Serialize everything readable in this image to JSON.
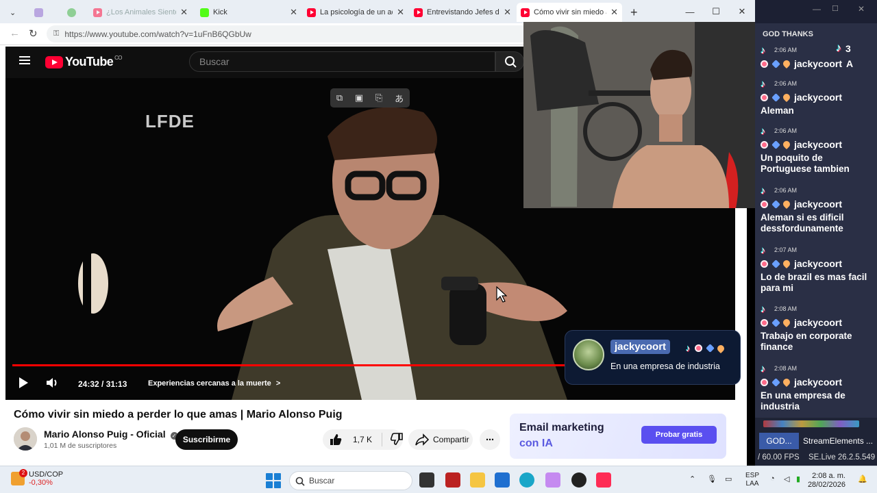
{
  "browser": {
    "tabs": [
      {
        "title": "",
        "muted": true,
        "active": false
      },
      {
        "title": "",
        "muted": true,
        "active": false
      },
      {
        "title": "¿Los Animales Sienten A",
        "muted": true,
        "active": false
      },
      {
        "title": "Kick",
        "muted": false,
        "active": false
      },
      {
        "title": "La psicología de un adic",
        "muted": false,
        "active": false
      },
      {
        "title": "Entrevistando Jefes de N",
        "muted": false,
        "active": false
      },
      {
        "title": "Cómo vivir sin miedo a p",
        "muted": false,
        "active": true
      }
    ],
    "new_tab": "+",
    "url": "https://www.youtube.com/watch?v=1uFnB6QGbUw"
  },
  "youtube": {
    "logo_text": "YouTube",
    "country": "CO",
    "search_placeholder": "Buscar",
    "video": {
      "watermark": "LFDE",
      "progress": 0.785,
      "time": "24:32 / 31:13",
      "chapter": "Experiencias cercanas a la muerte",
      "chapter_chevron": ">"
    },
    "title": "Cómo vivir sin miedo a perder lo que amas | Mario Alonso Puig",
    "channel": {
      "name": "Mario Alonso Puig - Oficial",
      "subscribers": "1,01 M de suscriptores",
      "subscribe_label": "Suscribirme"
    },
    "likes": "1,7 K",
    "share_label": "Compartir",
    "more_label": "⋯",
    "ad": {
      "line1": "Email marketing",
      "line2": "con IA",
      "cta": "Probar gratis"
    }
  },
  "popup": {
    "user": "jackycoort",
    "message": "En una empresa de industria"
  },
  "chat": {
    "header": "GOD THANKS",
    "tiktok_count": "3",
    "messages": [
      {
        "time": "2:06 AM",
        "user": "jackycoort",
        "suffix": "A",
        "text": ""
      },
      {
        "time": "2:06 AM",
        "user": "jackycoort",
        "suffix": "",
        "text": "Aleman"
      },
      {
        "time": "2:06 AM",
        "user": "jackycoort",
        "suffix": "",
        "text": "Un poquito de Portuguese tambien"
      },
      {
        "time": "2:06 AM",
        "user": "jackycoort",
        "suffix": "",
        "text": "Aleman si es dificil dessfordunamente"
      },
      {
        "time": "2:07 AM",
        "user": "jackycoort",
        "suffix": "",
        "text": "Lo de brazil es mas facil para mi"
      },
      {
        "time": "2:08 AM",
        "user": "jackycoort",
        "suffix": "",
        "text": "Trabajo en corporate finance"
      },
      {
        "time": "2:08 AM",
        "user": "jackycoort",
        "suffix": "",
        "text": "En una empresa de industria"
      }
    ],
    "tab_god": "GOD...",
    "tab_streamelements": "StreamElements ...",
    "fps": "/ 60.00 FPS",
    "selive": "SE.Live 26.2.5.549"
  },
  "taskbar": {
    "ticker_badge": "2",
    "ticker_name": "USD/COP",
    "ticker_value": "-0,30%",
    "search_placeholder": "Buscar",
    "lang_line1": "ESP",
    "lang_line2": "LAA",
    "time": "2:08 a. m.",
    "date": "28/02/2026"
  },
  "colors": {
    "youtube_red": "#ff0033",
    "chat_bg": "#2a2f45",
    "popup_bg": "#0d1a33",
    "ad_cta": "#5a4ff0"
  }
}
